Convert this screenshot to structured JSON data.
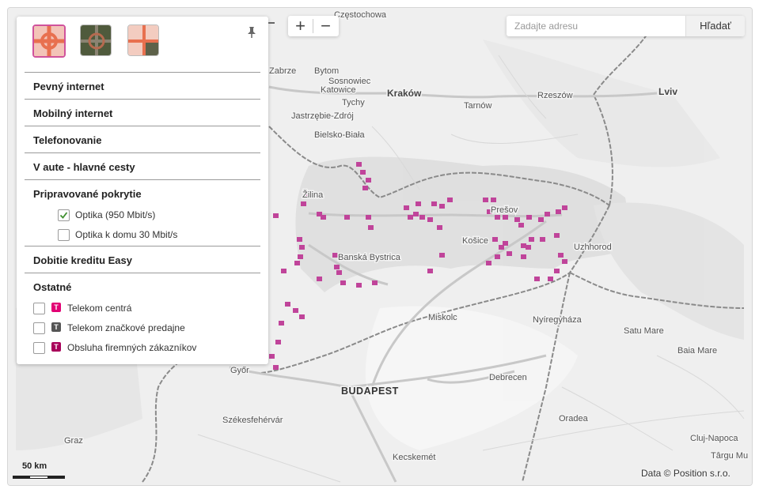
{
  "layers": [
    {
      "name": "Mapa",
      "active": true
    },
    {
      "name": "Satelit",
      "active": false
    },
    {
      "name": "Hybrid",
      "active": false
    }
  ],
  "menu": {
    "fixed_internet": "Pevný internet",
    "mobile_internet": "Mobilný internet",
    "calling": "Telefonovanie",
    "car_roads": "V aute - hlavné cesty",
    "planned": "Pripravované pokrytie",
    "planned_options": [
      {
        "label": "Optika (950 Mbit/s)",
        "checked": true
      },
      {
        "label": "Optika k domu 30 Mbit/s",
        "checked": false
      }
    ],
    "easy_topup": "Dobitie kreditu Easy",
    "other": "Ostatné",
    "other_options": [
      {
        "label": "Telekom centrá",
        "badge": "T",
        "badge_color": "#e20074",
        "checked": false
      },
      {
        "label": "Telekom značkové predajne",
        "badge": "T",
        "badge_color": "#555555",
        "checked": false
      },
      {
        "label": "Obsluha firemných zákazníkov",
        "badge": "T",
        "badge_color": "#a8005a",
        "checked": false
      }
    ]
  },
  "zoom": {
    "in": "+",
    "out": "−"
  },
  "search": {
    "placeholder": "Zadajte adresu",
    "button": "Hľadať"
  },
  "scale": {
    "label": "50 km"
  },
  "attribution": "Data © Position s.r.o.",
  "map": {
    "accent": "#c0449a",
    "cities": [
      "Częstochowa",
      "Zabrze",
      "Bytom",
      "Sosnowiec",
      "Katowice",
      "Tychy",
      "Kraków",
      "Tarnów",
      "Rzeszów",
      "Lviv",
      "Jastrzębie-Zdrój",
      "Bielsko-Biała",
      "Žilina",
      "Prešov",
      "Košice",
      "Banská Bystrica",
      "Uzhhorod",
      "Miskolc",
      "Nyíregyháza",
      "Satu Mare",
      "Baia Mare",
      "BUDAPEST",
      "Debrecen",
      "Székesfehérvár",
      "Győr",
      "Oradea",
      "Kecskemét",
      "Cluj-Napoca",
      "Târgu Mu",
      "Graz"
    ]
  }
}
